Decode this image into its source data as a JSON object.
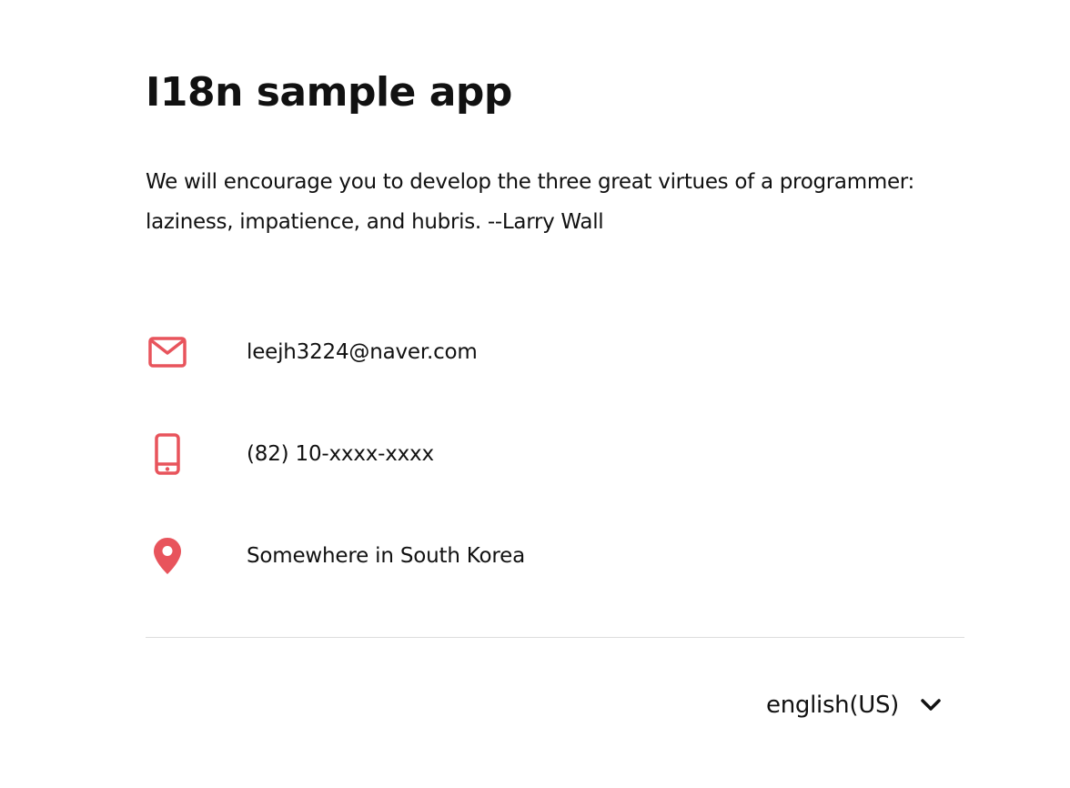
{
  "app": {
    "title": "I18n sample app"
  },
  "quote": {
    "text": "We will encourage you to develop the three great virtues of a programmer: laziness, impatience, and hubris. --Larry Wall"
  },
  "contacts": [
    {
      "icon": "mail-icon",
      "text": "leejh3224@naver.com"
    },
    {
      "icon": "phone-icon",
      "text": "(82) 10-xxxx-xxxx"
    },
    {
      "icon": "location-pin-icon",
      "text": "Somewhere in South Korea"
    }
  ],
  "language_selector": {
    "selected": "english(US)",
    "icon": "chevron-down-icon"
  },
  "colors": {
    "accent": "#e8545c",
    "text": "#111111",
    "divider": "#dddddd"
  }
}
